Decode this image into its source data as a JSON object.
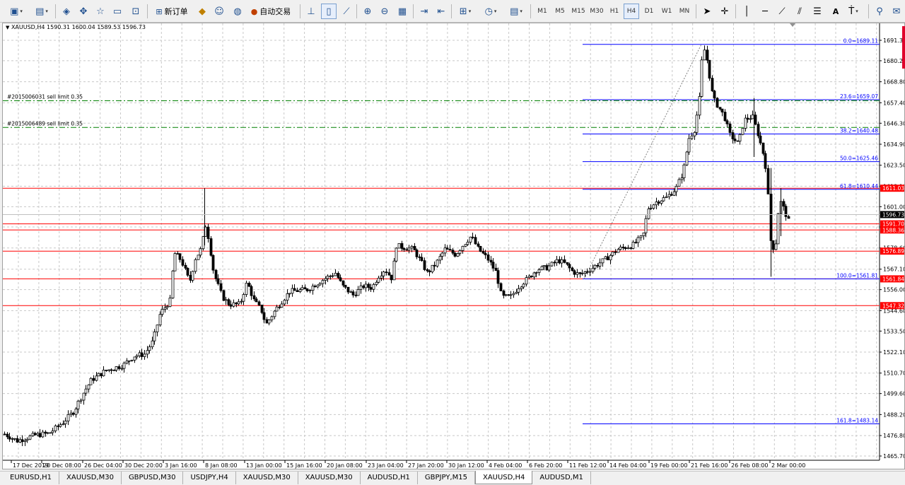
{
  "toolbar": {
    "new_order_label": "新订单",
    "autotrading_label": "自动交易",
    "timeframes": [
      "M1",
      "M5",
      "M15",
      "M30",
      "H1",
      "H4",
      "D1",
      "W1",
      "MN"
    ],
    "active_timeframe": "H4",
    "text_tool_label": "A"
  },
  "chart": {
    "symbol_info": "XAUUSD,H4  1590.31 1600.04 1589.53 1596.73",
    "price_axis": [
      "1691.30",
      "1680.20",
      "1668.80",
      "1657.40",
      "1646.30",
      "1634.90",
      "1623.50",
      "1612.10",
      "1601.00",
      "1590.00",
      "1578.60",
      "1567.10",
      "1556.00",
      "1544.60",
      "1533.50",
      "1522.10",
      "1510.70",
      "1499.60",
      "1488.20",
      "1476.80",
      "1465.70"
    ],
    "time_axis": [
      "17 Dec 2019",
      "20 Dec 08:00",
      "26 Dec 04:00",
      "30 Dec 20:00",
      "3 Jan 16:00",
      "8 Jan 08:00",
      "13 Jan 00:00",
      "15 Jan 16:00",
      "20 Jan 08:00",
      "23 Jan 04:00",
      "27 Jan 20:00",
      "30 Jan 12:00",
      "4 Feb 04:00",
      "6 Feb 20:00",
      "11 Feb 12:00",
      "14 Feb 04:00",
      "19 Feb 00:00",
      "21 Feb 16:00",
      "26 Feb 08:00",
      "2 Mar 00:00"
    ],
    "current_price": "1596.73",
    "fib_levels": [
      {
        "label": "0.0=1689.11",
        "price": 1689.11
      },
      {
        "label": "23.6=1659.07",
        "price": 1659.07
      },
      {
        "label": "38.2=1640.48",
        "price": 1640.48
      },
      {
        "label": "50.0=1625.46",
        "price": 1625.46
      },
      {
        "label": "61.8=1610.44",
        "price": 1610.44
      },
      {
        "label": "100.0=1561.81",
        "price": 1561.81
      },
      {
        "label": "161.8=1483.14",
        "price": 1483.14
      }
    ],
    "horizontal_lines": [
      {
        "label": "1611.03",
        "price": 1611.03
      },
      {
        "label": "1591.70",
        "price": 1591.7
      },
      {
        "label": "1588.36",
        "price": 1588.36
      },
      {
        "label": "1576.89",
        "price": 1576.89
      },
      {
        "label": "1561.84",
        "price": 1561.84
      },
      {
        "label": "1547.32",
        "price": 1547.32
      }
    ],
    "pending_orders": [
      {
        "label": "#2015006031 sell limit 0.35",
        "price": 1658.5
      },
      {
        "label": "#2015006489 sell limit 0.35",
        "price": 1644.0
      }
    ],
    "colors": {
      "fib": "#0000ff",
      "hline": "#ff0000",
      "order": "#008000",
      "candle": "#000000",
      "grid": "#c0c0c0"
    }
  },
  "tabs": [
    "EURUSD,H1",
    "XAUUSD,M30",
    "GBPUSD,M30",
    "USDJPY,H4",
    "XAUUSD,M30",
    "XAUUSD,M30",
    "AUDUSD,H1",
    "GBPJPY,M15",
    "XAUUSD,H4",
    "AUDUSD,M1"
  ],
  "active_tab": 8
}
